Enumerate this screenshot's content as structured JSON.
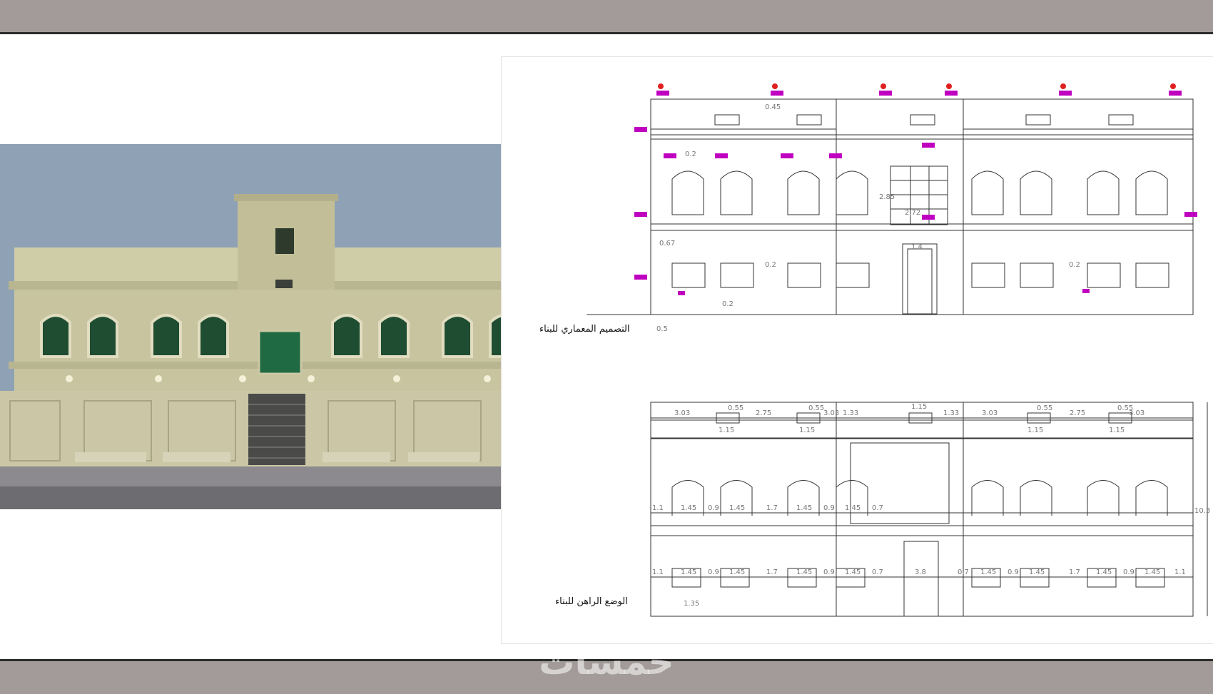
{
  "labels": {
    "architectural_design": "التصميم المعماري للبناء",
    "current_state": "الوضع الراهن للبناء"
  },
  "watermark": "خمسات",
  "colors": {
    "frame_bar": "#a29b99",
    "facade": "#c9c6a0",
    "window_glass": "#1f5a3a",
    "sky": "#8da0b3",
    "cad_line": "#333333",
    "cad_tag": "#c000c0"
  },
  "dimensions": {
    "top_widths": [
      "3.03",
      "2.75",
      "3.03",
      "1.33",
      "1.15",
      "1.33",
      "3.03",
      "2.75",
      "3.03"
    ],
    "top_sub": [
      "1.15",
      "1.15",
      "1.15",
      "1.15"
    ],
    "top_heights": [
      "0.55",
      "0.55",
      "0.55",
      "0.55"
    ],
    "row1": [
      "1.1",
      "1.45",
      "0.9",
      "1.45",
      "1.7",
      "1.45",
      "0.9",
      "1.45",
      "0.7"
    ],
    "row2": [
      "1.1",
      "1.45",
      "0.9",
      "1.45",
      "1.7",
      "1.45",
      "0.9",
      "1.45",
      "0.7",
      "3.8",
      "0.7",
      "1.45",
      "0.9",
      "1.45",
      "1.7",
      "1.45",
      "0.9",
      "1.45",
      "1.1"
    ],
    "height_total": "10.3",
    "left_height": "1.35"
  },
  "elevation_dims": [
    "0.45",
    "0.2",
    "2.85",
    "2.72",
    "1.4",
    "0.67",
    "0.2",
    "0.2",
    "0.2",
    "0.5"
  ]
}
